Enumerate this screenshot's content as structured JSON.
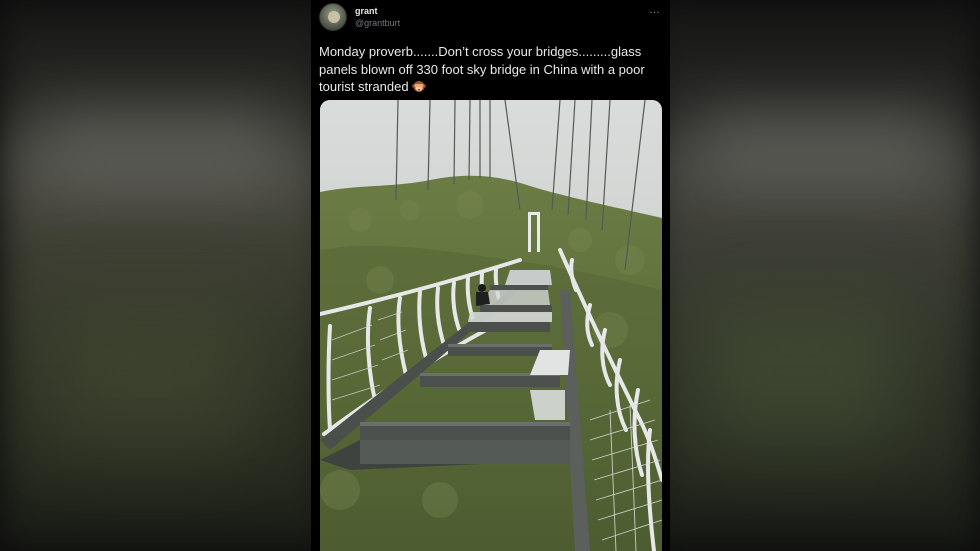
{
  "tweet": {
    "display_name": "grant",
    "handle": "@grantburt",
    "more_icon": "…",
    "text": "Monday proverb.......Don’t cross your bridges.........glass panels blown off 330 foot sky bridge in China with a poor tourist stranded",
    "emoji": "see-no-evil-monkey",
    "media_alt": "video frame of glass sky bridge with missing panels"
  },
  "colors": {
    "background": "#000000",
    "name": "#e7e9ea",
    "handle": "#71767b"
  }
}
